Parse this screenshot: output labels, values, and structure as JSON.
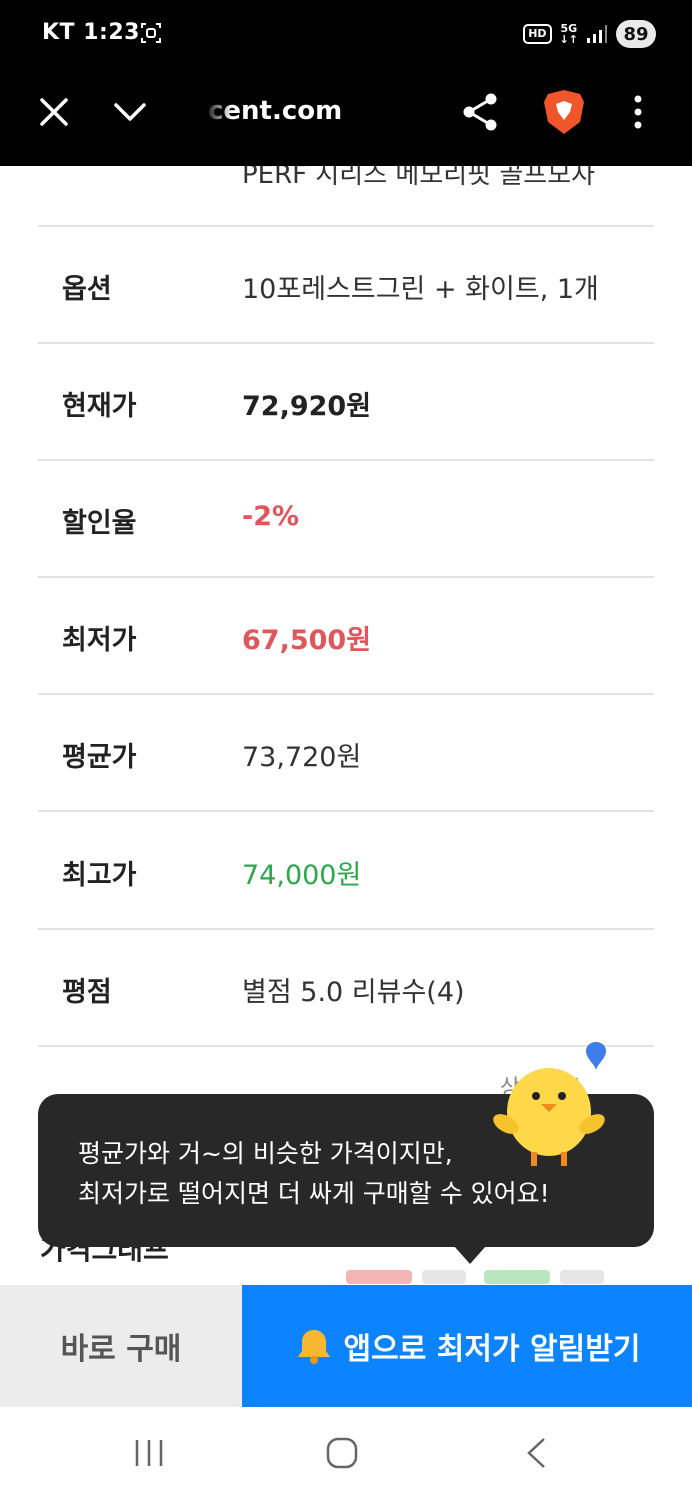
{
  "status_bar": {
    "carrier": "KT",
    "time": "1:23",
    "hd": "HD",
    "network": "5G",
    "battery": "89"
  },
  "browser": {
    "url": "cent.com"
  },
  "table": {
    "cut_row_value": "PERF 시리즈 메모리핏 골프모자",
    "rows": [
      {
        "label": "옵션",
        "value": "10포레스트그린 + 화이트, 1개"
      },
      {
        "label": "현재가",
        "value": "72,920원"
      },
      {
        "label": "할인율",
        "value": "-2%"
      },
      {
        "label": "최저가",
        "value": "67,500원"
      },
      {
        "label": "평균가",
        "value": "73,720원"
      },
      {
        "label": "최고가",
        "value": "74,000원"
      },
      {
        "label": "평점",
        "value": "별점 5.0 리뷰수(4)"
      }
    ],
    "colors": {
      "discount": "#e2565b",
      "lowest": "#e2565b",
      "highest": "#2aa84a"
    }
  },
  "detail_link": "상세정보",
  "section_title": "가격그래프",
  "tooltip": {
    "line1": "평균가와 거~의 비슷한 가격이지만,",
    "line2": "최저가로 떨어지면 더 싸게 구매할 수 있어요!"
  },
  "bottom": {
    "buy_now": "바로 구매",
    "alert": "앱으로 최저가 알림받기",
    "accent": "#0d84ff"
  }
}
